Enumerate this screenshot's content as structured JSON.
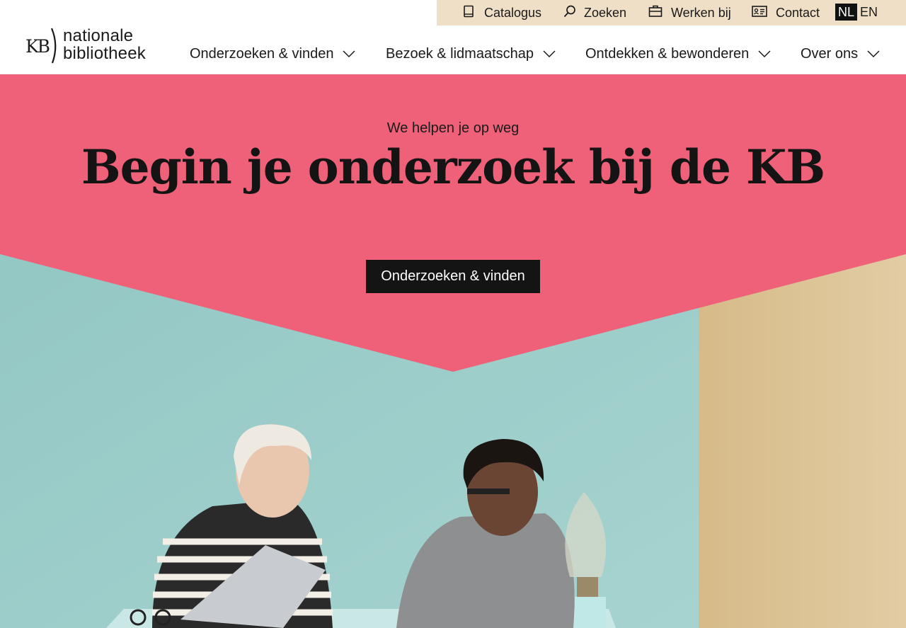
{
  "utility": {
    "catalogus": "Catalogus",
    "zoeken": "Zoeken",
    "werken_bij": "Werken bij",
    "contact": "Contact",
    "lang_nl": "NL",
    "lang_en": "EN",
    "active_lang": "NL"
  },
  "logo": {
    "mark": "KB",
    "line1": "nationale",
    "line2": "bibliotheek"
  },
  "nav": {
    "items": [
      {
        "label": "Onderzoeken & vinden"
      },
      {
        "label": "Bezoek & lidmaatschap"
      },
      {
        "label": "Ontdekken & bewonderen"
      },
      {
        "label": "Over ons"
      }
    ]
  },
  "hero": {
    "kicker": "We helpen je op weg",
    "title": "Begin je onderzoek bij de KB",
    "cta": "Onderzoeken & vinden"
  },
  "colors": {
    "utility_bg": "#efdfc6",
    "hero_pink": "#ef6179",
    "teal_wall": "#9ccfcc",
    "sand_wall": "#d9bf8e",
    "button_bg": "#141414"
  },
  "icons": {
    "catalogus": "book-icon",
    "zoeken": "search-icon",
    "werken_bij": "briefcase-icon",
    "contact": "contact-card-icon",
    "nav_chevron": "chevron-down-icon"
  }
}
